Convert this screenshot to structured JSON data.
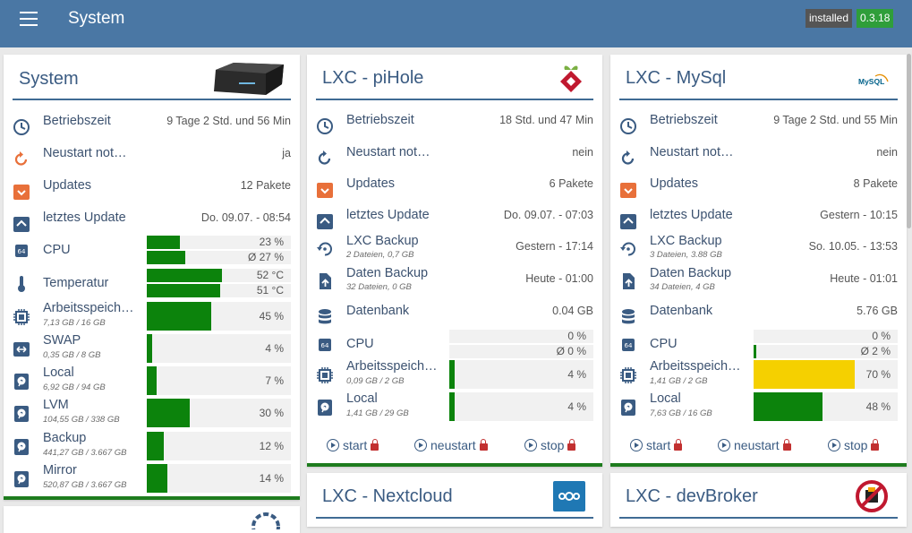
{
  "app": {
    "title": "System",
    "badge_installed": "installed",
    "badge_version": "0.3.18"
  },
  "cards": {
    "system": {
      "title": "System",
      "rows": {
        "uptime": {
          "label": "Betriebszeit",
          "value": "9 Tage 2 Std. und 56 Min"
        },
        "restart": {
          "label": "Neustart not…",
          "value": "ja"
        },
        "updates": {
          "label": "Updates",
          "value": "12 Pakete"
        },
        "lastupdate": {
          "label": "letztes Update",
          "value": "Do. 09.07. - 08:54"
        },
        "cpu": {
          "label": "CPU",
          "bar1": "23 %",
          "bar2": "Ø 27 %"
        },
        "temp": {
          "label": "Temperatur",
          "bar1": "52 °C",
          "bar2": "51 °C"
        },
        "mem": {
          "label": "Arbeitsspeich…",
          "sub": "7,13 GB / 16 GB",
          "bar": "45 %"
        },
        "swap": {
          "label": "SWAP",
          "sub": "0,35 GB / 8 GB",
          "bar": "4 %"
        },
        "local": {
          "label": "Local",
          "sub": "6,92 GB / 94 GB",
          "bar": "7 %"
        },
        "lvm": {
          "label": "LVM",
          "sub": "104,55 GB / 338 GB",
          "bar": "30 %"
        },
        "backup": {
          "label": "Backup",
          "sub": "441,27 GB / 3.667 GB",
          "bar": "12 %"
        },
        "mirror": {
          "label": "Mirror",
          "sub": "520,87 GB / 3.667 GB",
          "bar": "14 %"
        }
      },
      "levels": {
        "cpu1": 0.23,
        "cpu2": 0.27,
        "temp1": 0.52,
        "temp2": 0.51,
        "mem": 0.45,
        "swap": 0.04,
        "local": 0.07,
        "lvm": 0.3,
        "backup": 0.12,
        "mirror": 0.14
      }
    },
    "pihole": {
      "title": "LXC - piHole",
      "rows": {
        "uptime": {
          "label": "Betriebszeit",
          "value": "18 Std. und 47 Min"
        },
        "restart": {
          "label": "Neustart not…",
          "value": "nein"
        },
        "updates": {
          "label": "Updates",
          "value": "6 Pakete"
        },
        "lastupdate": {
          "label": "letztes Update",
          "value": "Do. 09.07. - 07:03"
        },
        "lxcbackup": {
          "label": "LXC Backup",
          "sub": "2 Dateien, 0,7 GB",
          "value": "Gestern - 17:14"
        },
        "databackup": {
          "label": "Daten Backup",
          "sub": "32 Dateien, 0 GB",
          "value": "Heute - 01:00"
        },
        "db": {
          "label": "Datenbank",
          "value": "0.04 GB"
        },
        "cpu": {
          "label": "CPU",
          "bar1": "0 %",
          "bar2": "Ø 0 %"
        },
        "mem": {
          "label": "Arbeitsspeich…",
          "sub": "0,09 GB / 2 GB",
          "bar": "4 %"
        },
        "local": {
          "label": "Local",
          "sub": "1,41 GB / 29 GB",
          "bar": "4 %"
        }
      },
      "levels": {
        "cpu1": 0,
        "cpu2": 0,
        "mem": 0.04,
        "local": 0.04
      },
      "actions": {
        "start": "start",
        "restart": "neustart",
        "stop": "stop"
      }
    },
    "mysql": {
      "title": "LXC - MySql",
      "logo_text": "MySQL",
      "rows": {
        "uptime": {
          "label": "Betriebszeit",
          "value": "9 Tage 2 Std. und 55 Min"
        },
        "restart": {
          "label": "Neustart not…",
          "value": "nein"
        },
        "updates": {
          "label": "Updates",
          "value": "8 Pakete"
        },
        "lastupdate": {
          "label": "letztes Update",
          "value": "Gestern - 10:15"
        },
        "lxcbackup": {
          "label": "LXC Backup",
          "sub": "3 Dateien, 3.88 GB",
          "value": "So. 10.05. - 13:53"
        },
        "databackup": {
          "label": "Daten Backup",
          "sub": "34 Dateien, 4 GB",
          "value": "Heute - 01:01"
        },
        "db": {
          "label": "Datenbank",
          "value": "5.76 GB"
        },
        "cpu": {
          "label": "CPU",
          "bar1": "0 %",
          "bar2": "Ø 2 %"
        },
        "mem": {
          "label": "Arbeitsspeich…",
          "sub": "1,41 GB / 2 GB",
          "bar": "70 %"
        },
        "local": {
          "label": "Local",
          "sub": "7,63 GB / 16 GB",
          "bar": "48 %"
        }
      },
      "levels": {
        "cpu1": 0,
        "cpu2": 0.02,
        "mem": 0.7,
        "local": 0.48
      },
      "actions": {
        "start": "start",
        "restart": "neustart",
        "stop": "stop"
      }
    },
    "nextcloud": {
      "title": "LXC - Nextcloud"
    },
    "devbroker": {
      "title": "LXC - devBroker"
    }
  },
  "colors": {
    "header": "#4a77a4",
    "bar_green": "#0c830c",
    "bar_yellow": "#f5d000",
    "icon_blue": "#3a5b82",
    "icon_orange": "#e8703a"
  }
}
